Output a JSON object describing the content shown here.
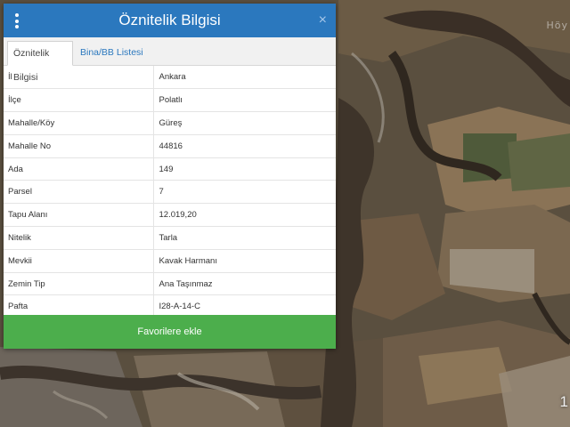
{
  "map": {
    "label_top": "Höy",
    "label_bottom": "1",
    "colors": {
      "base": "#5a4f3f",
      "field_light": "#8a7356",
      "field_dark": "#3e342a",
      "field_green": "#4f5a3a",
      "ridge": "#a8a399"
    }
  },
  "panel": {
    "title": "Öznitelik Bilgisi",
    "menu_icon": "kebab-menu-icon",
    "close_icon": "close-icon",
    "close_glyph": "×",
    "tabs": [
      {
        "label": "Öznitelik Bilgisi",
        "active": true
      },
      {
        "label": "Bina/BB Listesi",
        "active": false
      }
    ],
    "rows": [
      {
        "key": "İl",
        "value": "Ankara"
      },
      {
        "key": "İlçe",
        "value": "Polatlı"
      },
      {
        "key": "Mahalle/Köy",
        "value": "Güreş"
      },
      {
        "key": "Mahalle No",
        "value": "44816"
      },
      {
        "key": "Ada",
        "value": "149"
      },
      {
        "key": "Parsel",
        "value": "7"
      },
      {
        "key": "Tapu Alanı",
        "value": "12.019,20"
      },
      {
        "key": "Nitelik",
        "value": "Tarla"
      },
      {
        "key": "Mevkii",
        "value": "Kavak Harmanı"
      },
      {
        "key": "Zemin Tip",
        "value": "Ana Taşınmaz"
      },
      {
        "key": "Pafta",
        "value": "I28-A-14-C"
      }
    ],
    "favorite_button": "Favorilere ekle",
    "colors": {
      "header": "#2b78be",
      "button": "#4cae4c"
    }
  }
}
